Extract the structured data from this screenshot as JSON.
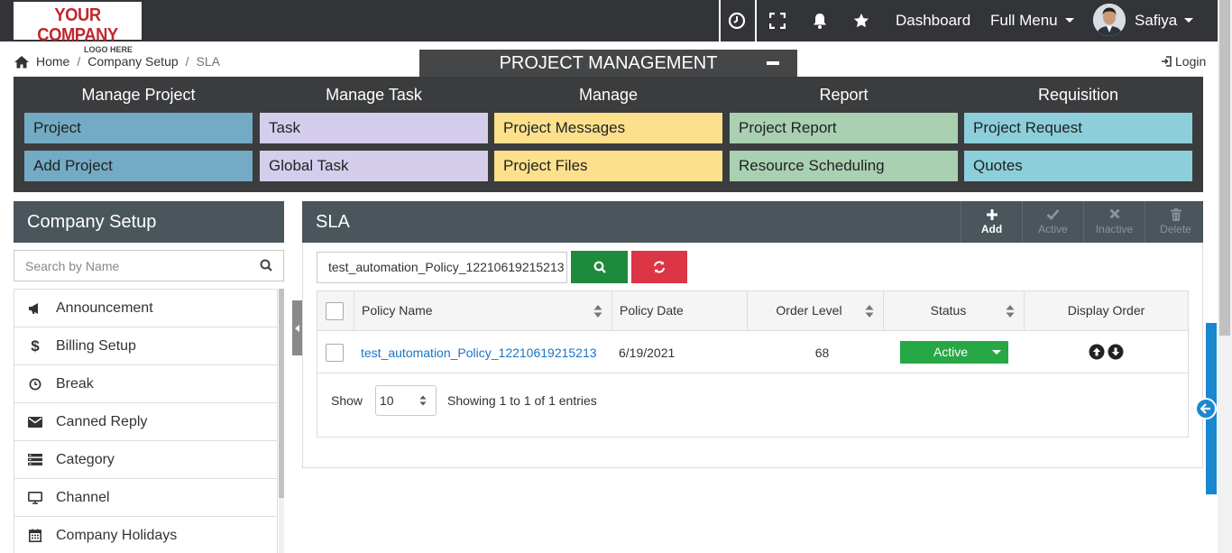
{
  "topbar": {
    "logo": {
      "line1": "YOUR COMPANY",
      "line2": "LOGO HERE"
    },
    "icons": [
      "clock-icon",
      "fullscreen-icon",
      "bell-icon",
      "star-icon"
    ],
    "dashboard_label": "Dashboard",
    "full_menu_label": "Full Menu",
    "user_name": "Safiya"
  },
  "breadcrumb": {
    "home": "Home",
    "parent": "Company Setup",
    "current": "SLA"
  },
  "login_label": "Login",
  "project_management": {
    "title": "PROJECT MANAGEMENT",
    "columns": [
      {
        "heading": "Manage Project",
        "items": [
          "Project",
          "Add Project"
        ],
        "color": "#73abc4"
      },
      {
        "heading": "Manage Task",
        "items": [
          "Task",
          "Global Task"
        ],
        "color": "#d4cdec"
      },
      {
        "heading": "Manage",
        "items": [
          "Project Messages",
          "Project Files"
        ],
        "color": "#fde08c"
      },
      {
        "heading": "Report",
        "items": [
          "Project Report",
          "Resource Scheduling"
        ],
        "color": "#a8d0b1"
      },
      {
        "heading": "Requisition",
        "items": [
          "Project Request",
          "Quotes"
        ],
        "color": "#8ccfdb"
      }
    ]
  },
  "sidebar": {
    "title": "Company Setup",
    "search_placeholder": "Search by Name",
    "items": [
      {
        "label": "Announcement",
        "icon": "megaphone-icon"
      },
      {
        "label": "Billing Setup",
        "icon": "dollar-icon"
      },
      {
        "label": "Break",
        "icon": "clock-icon"
      },
      {
        "label": "Canned Reply",
        "icon": "envelope-icon"
      },
      {
        "label": "Category",
        "icon": "category-icon"
      },
      {
        "label": "Channel",
        "icon": "monitor-icon"
      },
      {
        "label": "Company Holidays",
        "icon": "calendar-icon"
      }
    ]
  },
  "sla": {
    "title": "SLA",
    "actions": [
      {
        "label": "Add",
        "icon": "plus-icon",
        "enabled": true
      },
      {
        "label": "Active",
        "icon": "check-icon",
        "enabled": false
      },
      {
        "label": "Inactive",
        "icon": "x-icon",
        "enabled": false
      },
      {
        "label": "Delete",
        "icon": "trash-icon",
        "enabled": false
      }
    ],
    "filter_value": "test_automation_Policy_12210619215213",
    "table": {
      "columns": [
        "Policy Name",
        "Policy Date",
        "Order Level",
        "Status",
        "Display Order"
      ],
      "rows": [
        {
          "policy_name": "test_automation_Policy_12210619215213",
          "policy_date": "6/19/2021",
          "order_level": "68",
          "status": "Active"
        }
      ]
    },
    "page_size": "10",
    "show_label": "Show",
    "entries_info": "Showing 1 to 1 of 1 entries"
  },
  "colors": {
    "topbar": "#333438",
    "panel_header": "#4b555c",
    "search_button": "#1e8a3c",
    "reset_button": "#dc3545",
    "status_active": "#28a745",
    "side_tab": "#1a88d0"
  }
}
